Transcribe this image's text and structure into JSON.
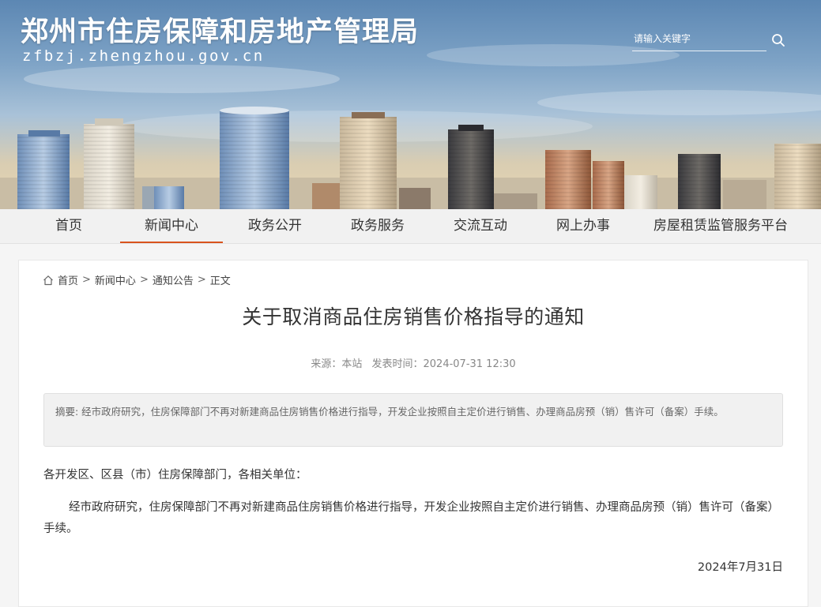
{
  "site": {
    "title": "郑州市住房保障和房地产管理局",
    "domain": "zfbzj.zhengzhou.gov.cn"
  },
  "search": {
    "placeholder": "请输入关键字",
    "icon": "search-icon"
  },
  "nav": {
    "items": [
      {
        "label": "首页"
      },
      {
        "label": "新闻中心",
        "active": true
      },
      {
        "label": "政务公开"
      },
      {
        "label": "政务服务"
      },
      {
        "label": "交流互动"
      },
      {
        "label": "网上办事"
      },
      {
        "label": "房屋租赁监管服务平台"
      }
    ],
    "active_color": "#d9541e"
  },
  "breadcrumb": {
    "icon": "home-icon",
    "items": [
      "首页",
      "新闻中心",
      "通知公告",
      "正文"
    ],
    "separator": ">"
  },
  "article": {
    "title": "关于取消商品住房销售价格指导的通知",
    "source": "来源：本站",
    "publish_time": "发表时间：2024-07-31 12:30",
    "summary": "摘要: 经市政府研究，住房保障部门不再对新建商品住房销售价格进行指导，开发企业按照自主定价进行销售、办理商品房预（销）售许可（备案）手续。",
    "greeting": "各开发区、区县（市）住房保障部门，各相关单位：",
    "paragraph": "经市政府研究，住房保障部门不再对新建商品住房销售价格进行指导，开发企业按照自主定价进行销售、办理商品房预（销）售许可（备案）手续。",
    "date": "2024年7月31日"
  }
}
